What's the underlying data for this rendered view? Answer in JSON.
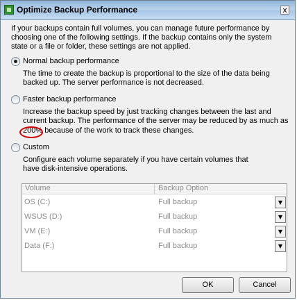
{
  "window": {
    "title": "Optimize Backup Performance",
    "close_glyph": "x"
  },
  "intro": "If your backups contain full volumes, you can manage future performance by choosing one of the following settings. If the backup contains only the system state or a file or folder, these settings are not applied.",
  "options": {
    "normal": {
      "label": "Normal backup performance",
      "checked": true,
      "description": "The time to create the backup is proportional to the size of the data being backed up. The server performance is not decreased."
    },
    "faster": {
      "label": "Faster backup performance",
      "checked": false,
      "description_line1": "Increase the backup speed by just tracking changes between the last and",
      "description_line2": "current backup. The performance of the server may be reduced by as much as",
      "description_line3": "200% because of the work to track these changes."
    },
    "custom": {
      "label": "Custom",
      "checked": false,
      "description": "Configure each volume separately if you have certain volumes that have disk-intensive operations."
    }
  },
  "volume_grid": {
    "headers": {
      "volume": "Volume",
      "backup_option": "Backup Option"
    },
    "rows": [
      {
        "volume": "OS (C:)",
        "option": "Full backup"
      },
      {
        "volume": "WSUS (D:)",
        "option": "Full backup"
      },
      {
        "volume": "VM (E:)",
        "option": "Full backup"
      },
      {
        "volume": "Data (F:)",
        "option": "Full backup"
      }
    ],
    "dropdown_glyph": "▼"
  },
  "buttons": {
    "ok": "OK",
    "cancel": "Cancel"
  },
  "colors": {
    "annotation_circle": "#d40000",
    "disabled_text": "#8c8c8c"
  }
}
